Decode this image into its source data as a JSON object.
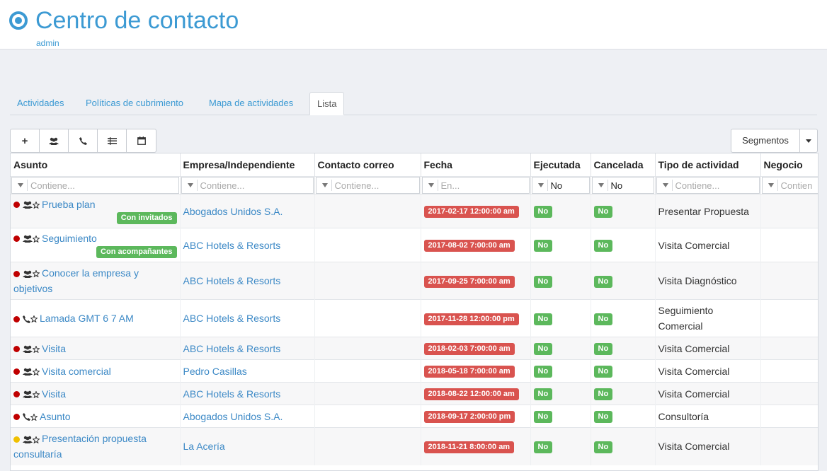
{
  "header": {
    "title": "Centro de contacto",
    "user": "admin"
  },
  "tabs": [
    {
      "label": "Actividades"
    },
    {
      "label": "Políticas de cubrimiento"
    },
    {
      "label": "Mapa de actividades"
    },
    {
      "label": "Lista"
    }
  ],
  "toolbar": {
    "add_icon": "+",
    "group_icon": "group-icon",
    "call_icon": "phone-icon",
    "list_icon": "list-icon",
    "calendar_icon": "calendar-icon"
  },
  "segments": {
    "label": "Segmentos"
  },
  "table": {
    "columns": [
      "Asunto",
      "Empresa/Independiente",
      "Contacto correo",
      "Fecha",
      "Ejecutada",
      "Cancelada",
      "Tipo de actividad",
      "Negocio"
    ],
    "filters": [
      "Contiene...",
      "Contiene...",
      "Contiene...",
      "En...",
      "No",
      "No",
      "Contiene...",
      "Contien"
    ],
    "rows": [
      {
        "status": "red",
        "icon": "group",
        "subject": "Prueba plan",
        "tag": "Con invitados",
        "company": "Abogados Unidos S.A.",
        "date": "2017-02-17 12:00:00 am",
        "executed": "No",
        "cancelled": "No",
        "type": "Presentar Propuesta"
      },
      {
        "status": "red",
        "icon": "group",
        "subject": "Seguimiento",
        "tag": "Con acompañantes",
        "company": "ABC Hotels & Resorts",
        "date": "2017-08-02 7:00:00 am",
        "executed": "No",
        "cancelled": "No",
        "type": "Visita Comercial"
      },
      {
        "status": "red",
        "icon": "group",
        "subject": "Conocer la empresa y objetivos",
        "tag": "",
        "company": "ABC Hotels & Resorts",
        "date": "2017-09-25 7:00:00 am",
        "executed": "No",
        "cancelled": "No",
        "type": "Visita Diagnóstico"
      },
      {
        "status": "red",
        "icon": "phone",
        "subject": "Lamada GMT 6 7 AM",
        "tag": "",
        "company": "ABC Hotels & Resorts",
        "date": "2017-11-28 12:00:00 pm",
        "executed": "No",
        "cancelled": "No",
        "type": "Seguimiento Comercial"
      },
      {
        "status": "red",
        "icon": "group",
        "subject": "Visita",
        "tag": "",
        "company": "ABC Hotels & Resorts",
        "date": "2018-02-03 7:00:00 am",
        "executed": "No",
        "cancelled": "No",
        "type": "Visita Comercial"
      },
      {
        "status": "red",
        "icon": "group",
        "subject": "Visita comercial",
        "tag": "",
        "company": "Pedro Casillas",
        "date": "2018-05-18 7:00:00 am",
        "executed": "No",
        "cancelled": "No",
        "type": "Visita Comercial"
      },
      {
        "status": "red",
        "icon": "group",
        "subject": "Visita",
        "tag": "",
        "company": "ABC Hotels & Resorts",
        "date": "2018-08-22 12:00:00 am",
        "executed": "No",
        "cancelled": "No",
        "type": "Visita Comercial"
      },
      {
        "status": "red",
        "icon": "phone",
        "subject": "Asunto",
        "tag": "",
        "company": "Abogados Unidos S.A.",
        "date": "2018-09-17 2:00:00 pm",
        "executed": "No",
        "cancelled": "No",
        "type": "Consultoría"
      },
      {
        "status": "yellow",
        "icon": "group",
        "subject": "Presentación propuesta consultaría",
        "tag": "",
        "company": "La Acería",
        "date": "2018-11-21 8:00:00 am",
        "executed": "No",
        "cancelled": "No",
        "type": "Visita Comercial"
      }
    ]
  },
  "colors": {
    "accent": "#3c9ad3",
    "red": "#c00000",
    "yellow": "#f0c000",
    "green_badge": "#5cb85c",
    "red_badge": "#d9534f"
  }
}
